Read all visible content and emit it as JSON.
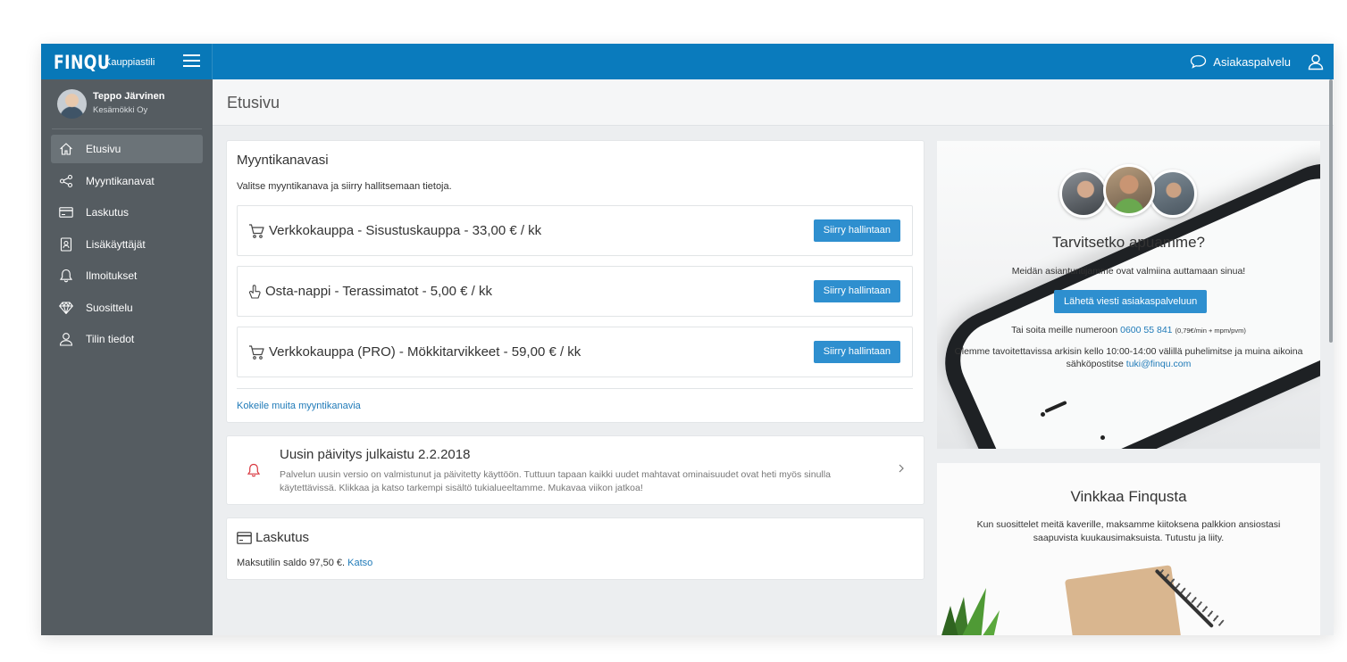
{
  "topbar": {
    "logo": "FINQU",
    "logo_sub": "Kauppiastili",
    "support_label": "Asiakaspalvelu"
  },
  "profile": {
    "name": "Teppo Järvinen",
    "company": "Kesämökki Oy"
  },
  "nav": [
    {
      "label": "Etusivu",
      "icon": "home-icon",
      "active": true
    },
    {
      "label": "Myyntikanavat",
      "icon": "share-icon"
    },
    {
      "label": "Laskutus",
      "icon": "credit-card-icon"
    },
    {
      "label": "Lisäkäyttäjät",
      "icon": "user-badge-icon"
    },
    {
      "label": "Ilmoitukset",
      "icon": "bell-icon"
    },
    {
      "label": "Suosittelu",
      "icon": "diamond-icon"
    },
    {
      "label": "Tilin tiedot",
      "icon": "user-icon"
    }
  ],
  "page": {
    "title": "Etusivu"
  },
  "channels": {
    "heading": "Myyntikanavasi",
    "subtitle": "Valitse myyntikanava ja siirry hallitsemaan tietoja.",
    "items": [
      {
        "label": "Verkkokauppa - Sisustuskauppa - 33,00 € / kk",
        "icon": "cart-icon",
        "button": "Siirry hallintaan"
      },
      {
        "label": "Osta-nappi - Terassimatot - 5,00 € / kk",
        "icon": "pointer-hand-icon",
        "button": "Siirry hallintaan"
      },
      {
        "label": "Verkkokauppa (PRO) - Mökkitarvikkeet - 59,00 € / kk",
        "icon": "cart-icon",
        "button": "Siirry hallintaan"
      }
    ],
    "more_link": "Kokeile muita myyntikanavia"
  },
  "update": {
    "title": "Uusin päivitys julkaistu 2.2.2018",
    "text": "Palvelun uusin versio on valmistunut ja päivitetty käyttöön. Tuttuun tapaan kaikki uudet mahtavat ominaisuudet ovat heti myös sinulla käytettävissä. Klikkaa ja katso tarkempi sisältö tukialueeltamme. Mukavaa viikon jatkoa!"
  },
  "billing": {
    "title": "Laskutus",
    "text": "Maksutilin saldo 97,50 €.",
    "link": "Katso"
  },
  "help": {
    "title": "Tarvitsetko apuamme?",
    "lead": "Meidän asiantuntijamme ovat valmiina auttamaan sinua!",
    "button": "Lähetä viesti asiakaspalveluun",
    "call_prefix": "Tai soita meille numeroon",
    "phone": "0600 55 841",
    "price": "(0,79€/min + mpm/pvm)",
    "hours_text": "Olemme tavoitettavissa arkisin kello 10:00-14:00 välillä puhelimitse ja muina aikoina sähköpostitse",
    "email": "tuki@finqu.com"
  },
  "referral": {
    "title": "Vinkkaa Finqusta",
    "text": "Kun suosittelet meitä kaverille, maksamme kiitoksena palkkion ansiostasi saapuvista kuukausimaksuista. Tutustu ja liity."
  },
  "colors": {
    "topbar": "#0a7bbd",
    "sidebar": "#555c61",
    "button": "#2e8fcf",
    "link": "#1f7ab8",
    "alert": "#d9363e"
  }
}
